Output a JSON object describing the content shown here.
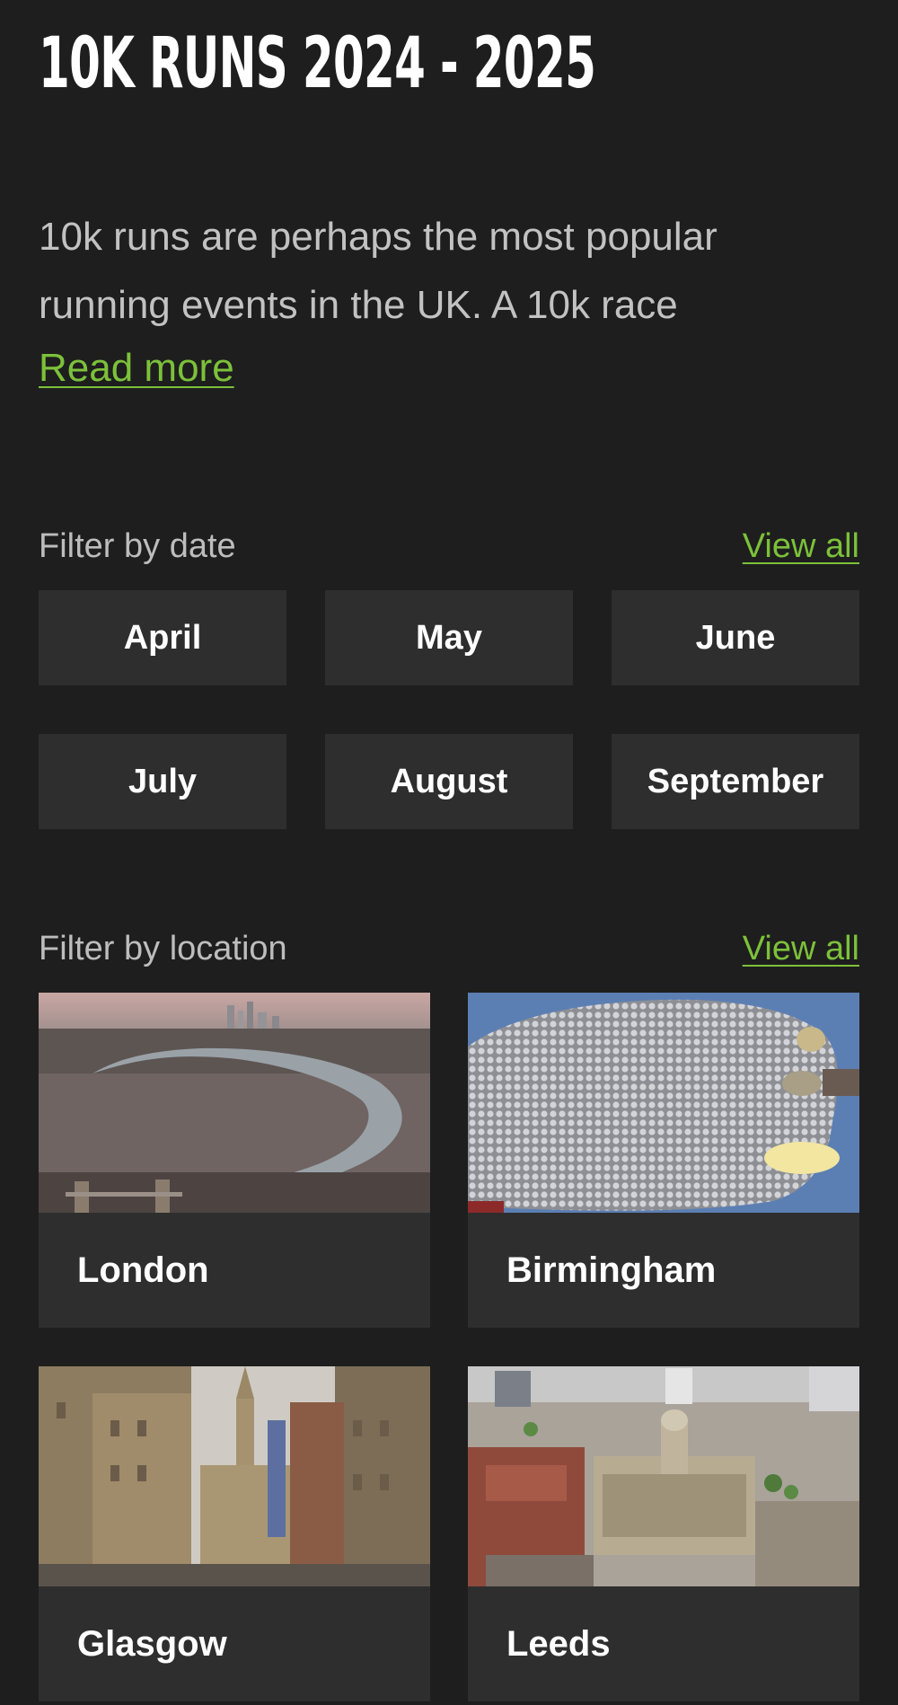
{
  "page": {
    "title": "10K RUNS 2024 - 2025",
    "intro": "10k runs are perhaps the most popular running events in the UK. A 10k race",
    "read_more": "Read more"
  },
  "date_filter": {
    "label": "Filter by date",
    "view_all": "View all",
    "months": [
      "April",
      "May",
      "June",
      "July",
      "August",
      "September"
    ]
  },
  "location_filter": {
    "label": "Filter by location",
    "view_all": "View all",
    "cities": [
      "London",
      "Birmingham",
      "Glasgow",
      "Leeds"
    ]
  },
  "colors": {
    "background": "#1e1e1e",
    "tile": "#2e2e2e",
    "accent": "#7cc13a"
  }
}
